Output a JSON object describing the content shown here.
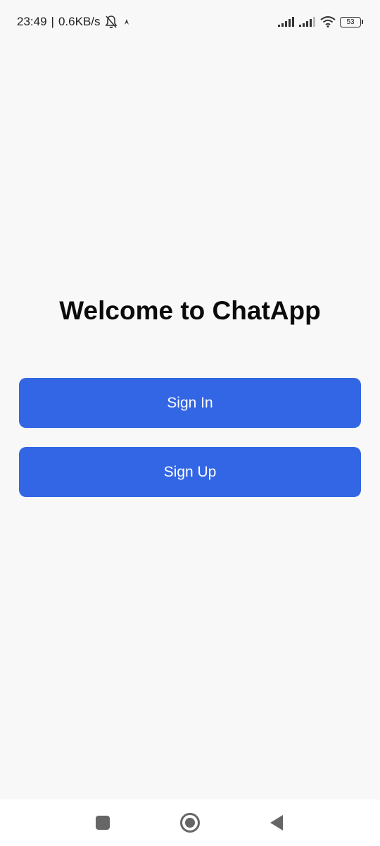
{
  "status_bar": {
    "time": "23:49",
    "separator": "|",
    "net_speed": "0.6KB/s",
    "battery_level": "53",
    "icons": [
      "notifications-off-icon",
      "arrow-icon",
      "signal-sim1-icon",
      "signal-sim2-icon",
      "wifi-icon",
      "battery-icon"
    ]
  },
  "main": {
    "title": "Welcome to ChatApp",
    "sign_in_label": "Sign In",
    "sign_up_label": "Sign Up"
  },
  "nav_bar": {
    "icons": [
      "recents-icon",
      "home-icon",
      "back-icon"
    ]
  },
  "colors": {
    "background": "#f8f8f8",
    "primary_button": "#3366e4",
    "button_text": "#ffffff",
    "title_text": "#0b0b0b"
  }
}
